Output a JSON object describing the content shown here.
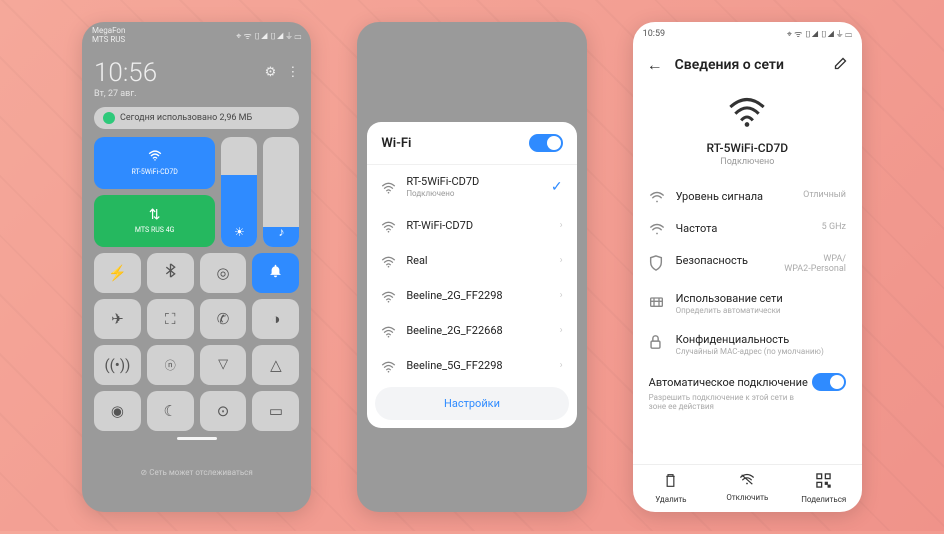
{
  "p1": {
    "carrier1": "MegaFon",
    "carrier2": "MTS RUS",
    "time": "10:56",
    "date": "Вт, 27 авг.",
    "usage": "Сегодня использовано 2,96 МБ",
    "wifi_tile": "RT-5WiFi-CD7D",
    "data_tile": "MTS RUS 4G",
    "footer": "⊘ Сеть может отслеживаться"
  },
  "p2": {
    "title": "Wi-Fi",
    "networks": [
      {
        "name": "RT-5WiFi-CD7D",
        "sub": "Подключено",
        "connected": true
      },
      {
        "name": "RT-WiFi-CD7D"
      },
      {
        "name": "Real"
      },
      {
        "name": "Beeline_2G_FF2298"
      },
      {
        "name": "Beeline_2G_F22668"
      },
      {
        "name": "Beeline_5G_FF2298"
      }
    ],
    "settings": "Настройки"
  },
  "p3": {
    "time": "10:59",
    "title": "Сведения о сети",
    "ssid": "RT-5WiFi-CD7D",
    "status": "Подключено",
    "items": [
      {
        "label": "Уровень сигнала",
        "value": "Отличный"
      },
      {
        "label": "Частота",
        "value": "5 GHz"
      },
      {
        "label": "Безопасность",
        "value": "WPA/\nWPA2-Personal"
      },
      {
        "label": "Использование сети",
        "sub": "Определить автоматически"
      },
      {
        "label": "Конфиденциальность",
        "sub": "Случайный MAC-адрес (по умолчанию)"
      }
    ],
    "auto_label": "Автоматическое подключение",
    "auto_sub": "Разрешить подключение к этой сети в зоне ее действия",
    "actions": [
      {
        "label": "Удалить"
      },
      {
        "label": "Отключить"
      },
      {
        "label": "Поделиться"
      }
    ]
  }
}
